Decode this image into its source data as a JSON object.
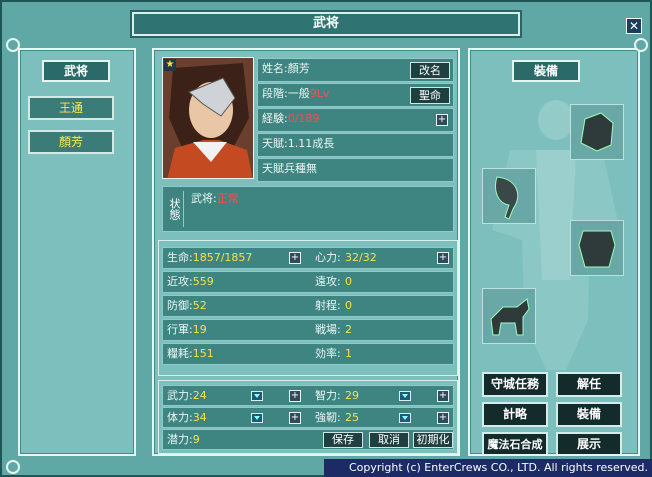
{
  "window": {
    "title": "武将",
    "close_label": "✕"
  },
  "left_panel": {
    "header": "武将",
    "generals": [
      {
        "name": "王通"
      },
      {
        "name": "顏芳"
      }
    ]
  },
  "profile": {
    "star": "★",
    "name_label": "姓名:",
    "name_value": "顏芳",
    "rename_button": "改名",
    "rank_label": "段階:",
    "rank_value": "一般",
    "rank_level": "9Lv",
    "fate_button": "聖命",
    "exp_label": "経験:",
    "exp_value": "0/189",
    "talent": "天賦:1.11成長",
    "talent_troop": "天賦兵種無",
    "status_label": "状態",
    "status_key": "武将:",
    "status_value": "正常"
  },
  "stats": {
    "hp_label": "生命:",
    "hp_value": "1857/1857",
    "mp_label": "心力:",
    "mp_value": "32/32",
    "melee_label": "近攻:",
    "melee_value": "559",
    "ranged_label": "遠攻:",
    "ranged_value": "0",
    "defense_label": "防御:",
    "defense_value": "52",
    "range_label": "射程:",
    "range_value": "0",
    "march_label": "行軍:",
    "march_value": "19",
    "battle_label": "戦場:",
    "battle_value": "2",
    "supply_label": "糧耗:",
    "supply_value": "151",
    "efficiency_label": "効率:",
    "efficiency_value": "1"
  },
  "attributes": {
    "str_label": "武力:",
    "str_value": "24",
    "int_label": "智力:",
    "int_value": "29",
    "vit_label": "体力:",
    "vit_value": "34",
    "tough_label": "強靭:",
    "tough_value": "25",
    "pot_label": "潜力:",
    "pot_value": "9",
    "save_button": "保存",
    "cancel_button": "取消",
    "reset_button": "初期化"
  },
  "equipment": {
    "header": "裝備"
  },
  "actions": {
    "guard_task": "守城任務",
    "dismiss": "解任",
    "strategy": "計略",
    "equip": "裝備",
    "magic_stone": "魔法石合成",
    "display": "展示"
  },
  "footer": {
    "copyright": "Copyright (c) EnterCrews CO., LTD. All rights reserved."
  },
  "colors": {
    "frame": "#5fa8a6",
    "panel": "#7cbfbd",
    "row": "#3e8582",
    "value_yellow": "#f2e44a",
    "value_red": "#ff4a4a"
  }
}
